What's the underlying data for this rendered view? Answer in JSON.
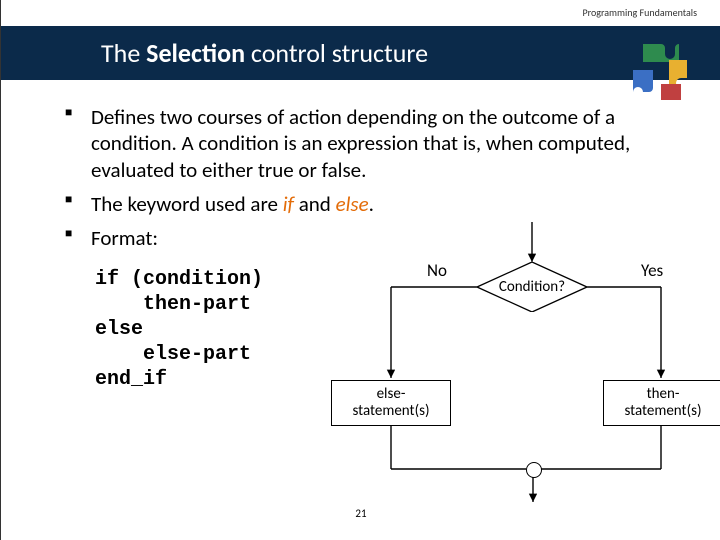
{
  "header": {
    "course": "Programming Fundamentals"
  },
  "title": {
    "plain_before": "The ",
    "bold": "Selection",
    "plain_after": " control structure"
  },
  "bullets": {
    "b1": "Defines two courses of action depending on the outcome of a condition. A condition is an expression that is, when computed, evaluated to either true or false.",
    "b2_before": "The keyword used are ",
    "b2_kw1": "if",
    "b2_mid": " and ",
    "b2_kw2": "else",
    "b2_after": ".",
    "b3": "Format:"
  },
  "code": "if (condition)\n    then-part\nelse\n    else-part\nend_if",
  "flow": {
    "no": "No",
    "yes": "Yes",
    "condition": "Condition?",
    "else_box": "else-\nstatement(s)",
    "then_box": "then-\nstatement(s)"
  },
  "page": "21"
}
